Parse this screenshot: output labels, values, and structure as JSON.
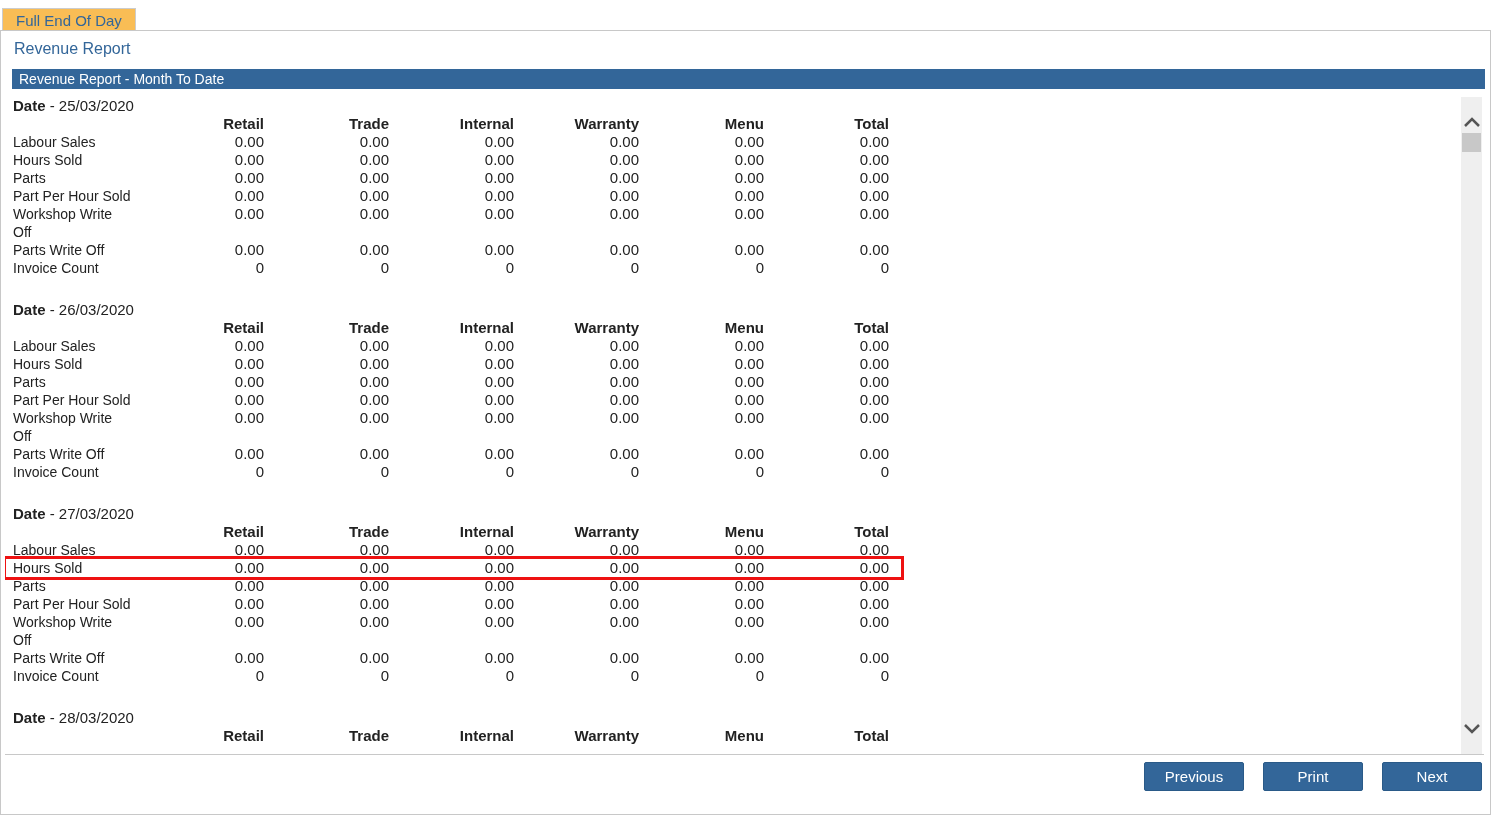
{
  "tabs": [
    {
      "label": "Full End Of Day",
      "selected": true
    }
  ],
  "page_title": "Revenue Report",
  "report_header": "Revenue Report - Month To Date",
  "sections": [
    {
      "date_line": "**Date** - 25/03/2020",
      "columns": [
        "Retail",
        "Trade",
        "Internal",
        "Warranty",
        "Menu",
        "Total"
      ],
      "rows": [
        {
          "label": "Labour Sales",
          "values": [
            "0.00",
            "0.00",
            "0.00",
            "0.00",
            "0.00",
            "0.00"
          ],
          "highlighted": false
        },
        {
          "label": "Hours Sold",
          "values": [
            "0.00",
            "0.00",
            "0.00",
            "0.00",
            "0.00",
            "0.00"
          ],
          "highlighted": false
        },
        {
          "label": "Parts",
          "values": [
            "0.00",
            "0.00",
            "0.00",
            "0.00",
            "0.00",
            "0.00"
          ],
          "highlighted": false
        },
        {
          "label": "Part Per Hour Sold",
          "values": [
            "0.00",
            "0.00",
            "0.00",
            "0.00",
            "0.00",
            "0.00"
          ],
          "highlighted": false
        },
        {
          "label": "Workshop Write Off",
          "values": [
            "0.00",
            "0.00",
            "0.00",
            "0.00",
            "0.00",
            "0.00"
          ],
          "highlighted": false
        },
        {
          "label": "Parts Write Off",
          "values": [
            "0.00",
            "0.00",
            "0.00",
            "0.00",
            "0.00",
            "0.00"
          ],
          "highlighted": false
        },
        {
          "label": "Invoice Count",
          "values": [
            "0",
            "0",
            "0",
            "0",
            "0",
            "0"
          ],
          "highlighted": false
        }
      ]
    },
    {
      "date_line": "**Date** - 26/03/2020",
      "columns": [
        "Retail",
        "Trade",
        "Internal",
        "Warranty",
        "Menu",
        "Total"
      ],
      "rows": [
        {
          "label": "Labour Sales",
          "values": [
            "0.00",
            "0.00",
            "0.00",
            "0.00",
            "0.00",
            "0.00"
          ],
          "highlighted": false
        },
        {
          "label": "Hours Sold",
          "values": [
            "0.00",
            "0.00",
            "0.00",
            "0.00",
            "0.00",
            "0.00"
          ],
          "highlighted": false
        },
        {
          "label": "Parts",
          "values": [
            "0.00",
            "0.00",
            "0.00",
            "0.00",
            "0.00",
            "0.00"
          ],
          "highlighted": false
        },
        {
          "label": "Part Per Hour Sold",
          "values": [
            "0.00",
            "0.00",
            "0.00",
            "0.00",
            "0.00",
            "0.00"
          ],
          "highlighted": false
        },
        {
          "label": "Workshop Write Off",
          "values": [
            "0.00",
            "0.00",
            "0.00",
            "0.00",
            "0.00",
            "0.00"
          ],
          "highlighted": false
        },
        {
          "label": "Parts Write Off",
          "values": [
            "0.00",
            "0.00",
            "0.00",
            "0.00",
            "0.00",
            "0.00"
          ],
          "highlighted": false
        },
        {
          "label": "Invoice Count",
          "values": [
            "0",
            "0",
            "0",
            "0",
            "0",
            "0"
          ],
          "highlighted": false
        }
      ]
    },
    {
      "date_line": "**Date** - 27/03/2020",
      "columns": [
        "Retail",
        "Trade",
        "Internal",
        "Warranty",
        "Menu",
        "Total"
      ],
      "rows": [
        {
          "label": "Labour Sales",
          "values": [
            "0.00",
            "0.00",
            "0.00",
            "0.00",
            "0.00",
            "0.00"
          ],
          "highlighted": false
        },
        {
          "label": "Hours Sold",
          "values": [
            "0.00",
            "0.00",
            "0.00",
            "0.00",
            "0.00",
            "0.00"
          ],
          "highlighted": true
        },
        {
          "label": "Parts",
          "values": [
            "0.00",
            "0.00",
            "0.00",
            "0.00",
            "0.00",
            "0.00"
          ],
          "highlighted": false
        },
        {
          "label": "Part Per Hour Sold",
          "values": [
            "0.00",
            "0.00",
            "0.00",
            "0.00",
            "0.00",
            "0.00"
          ],
          "highlighted": false
        },
        {
          "label": "Workshop Write Off",
          "values": [
            "0.00",
            "0.00",
            "0.00",
            "0.00",
            "0.00",
            "0.00"
          ],
          "highlighted": false
        },
        {
          "label": "Parts Write Off",
          "values": [
            "0.00",
            "0.00",
            "0.00",
            "0.00",
            "0.00",
            "0.00"
          ],
          "highlighted": false
        },
        {
          "label": "Invoice Count",
          "values": [
            "0",
            "0",
            "0",
            "0",
            "0",
            "0"
          ],
          "highlighted": false
        }
      ]
    },
    {
      "date_line": "**Date** - 28/03/2020",
      "columns": [
        "Retail",
        "Trade",
        "Internal",
        "Warranty",
        "Menu",
        "Total"
      ]
    }
  ],
  "buttons": [
    {
      "label": "Previous"
    },
    {
      "label": "Print"
    },
    {
      "label": "Next"
    }
  ]
}
